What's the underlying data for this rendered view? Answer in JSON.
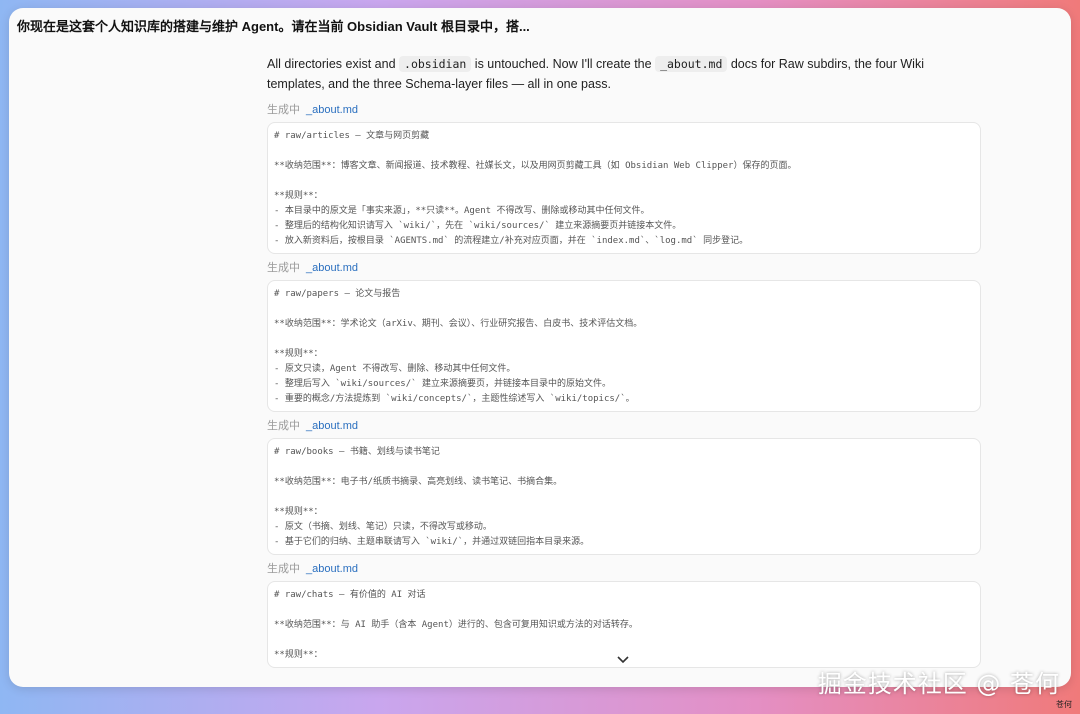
{
  "window_title": "你现在是这套个人知识库的搭建与维护 Agent。请在当前 Obsidian Vault 根目录中，搭...",
  "intro": {
    "part1": "All directories exist and ",
    "code1": ".obsidian",
    "part2": " is untouched. Now I'll create the ",
    "code2": "_about.md",
    "part3": " docs for Raw subdirs, the four Wiki templates, and the three Schema-layer files — all in one pass."
  },
  "blocks": [
    {
      "status": "生成中",
      "file": "_about.md",
      "lines": [
        "# raw/articles — 文章与网页剪藏",
        "",
        "**收纳范围**：博客文章、新闻报道、技术教程、社媒长文，以及用网页剪藏工具（如 Obsidian Web Clipper）保存的页面。",
        "",
        "**规则**：",
        "- 本目录中的原文是「事实来源」，**只读**。Agent 不得改写、删除或移动其中任何文件。",
        "- 整理后的结构化知识请写入 `wiki/`，先在 `wiki/sources/` 建立来源摘要页并链接本文件。",
        "- 放入新资料后，按根目录 `AGENTS.md` 的流程建立/补充对应页面，并在 `index.md`、`log.md` 同步登记。"
      ]
    },
    {
      "status": "生成中",
      "file": "_about.md",
      "lines": [
        "# raw/papers — 论文与报告",
        "",
        "**收纳范围**：学术论文（arXiv、期刊、会议）、行业研究报告、白皮书、技术评估文档。",
        "",
        "**规则**：",
        "- 原文只读，Agent 不得改写、删除、移动其中任何文件。",
        "- 整理后写入 `wiki/sources/` 建立来源摘要页，并链接本目录中的原始文件。",
        "- 重要的概念/方法提炼到 `wiki/concepts/`，主题性综述写入 `wiki/topics/`。"
      ]
    },
    {
      "status": "生成中",
      "file": "_about.md",
      "lines": [
        "# raw/books — 书籍、划线与读书笔记",
        "",
        "**收纳范围**：电子书/纸质书摘录、高亮划线、读书笔记、书摘合集。",
        "",
        "**规则**：",
        "- 原文（书摘、划线、笔记）只读，不得改写或移动。",
        "- 基于它们的归纳、主题串联请写入 `wiki/`，并通过双链回指本目录来源。"
      ]
    },
    {
      "status": "生成中",
      "file": "_about.md",
      "lines": [
        "# raw/chats — 有价值的 AI 对话",
        "",
        "**收纳范围**：与 AI 助手（含本 Agent）进行的、包含可复用知识或方法的对话转存。",
        "",
        "**规则**："
      ]
    }
  ],
  "chevron_icon": "chevron-down-icon",
  "watermark": "掘金技术社区 @ 苍何",
  "corner_mark": "苍何"
}
